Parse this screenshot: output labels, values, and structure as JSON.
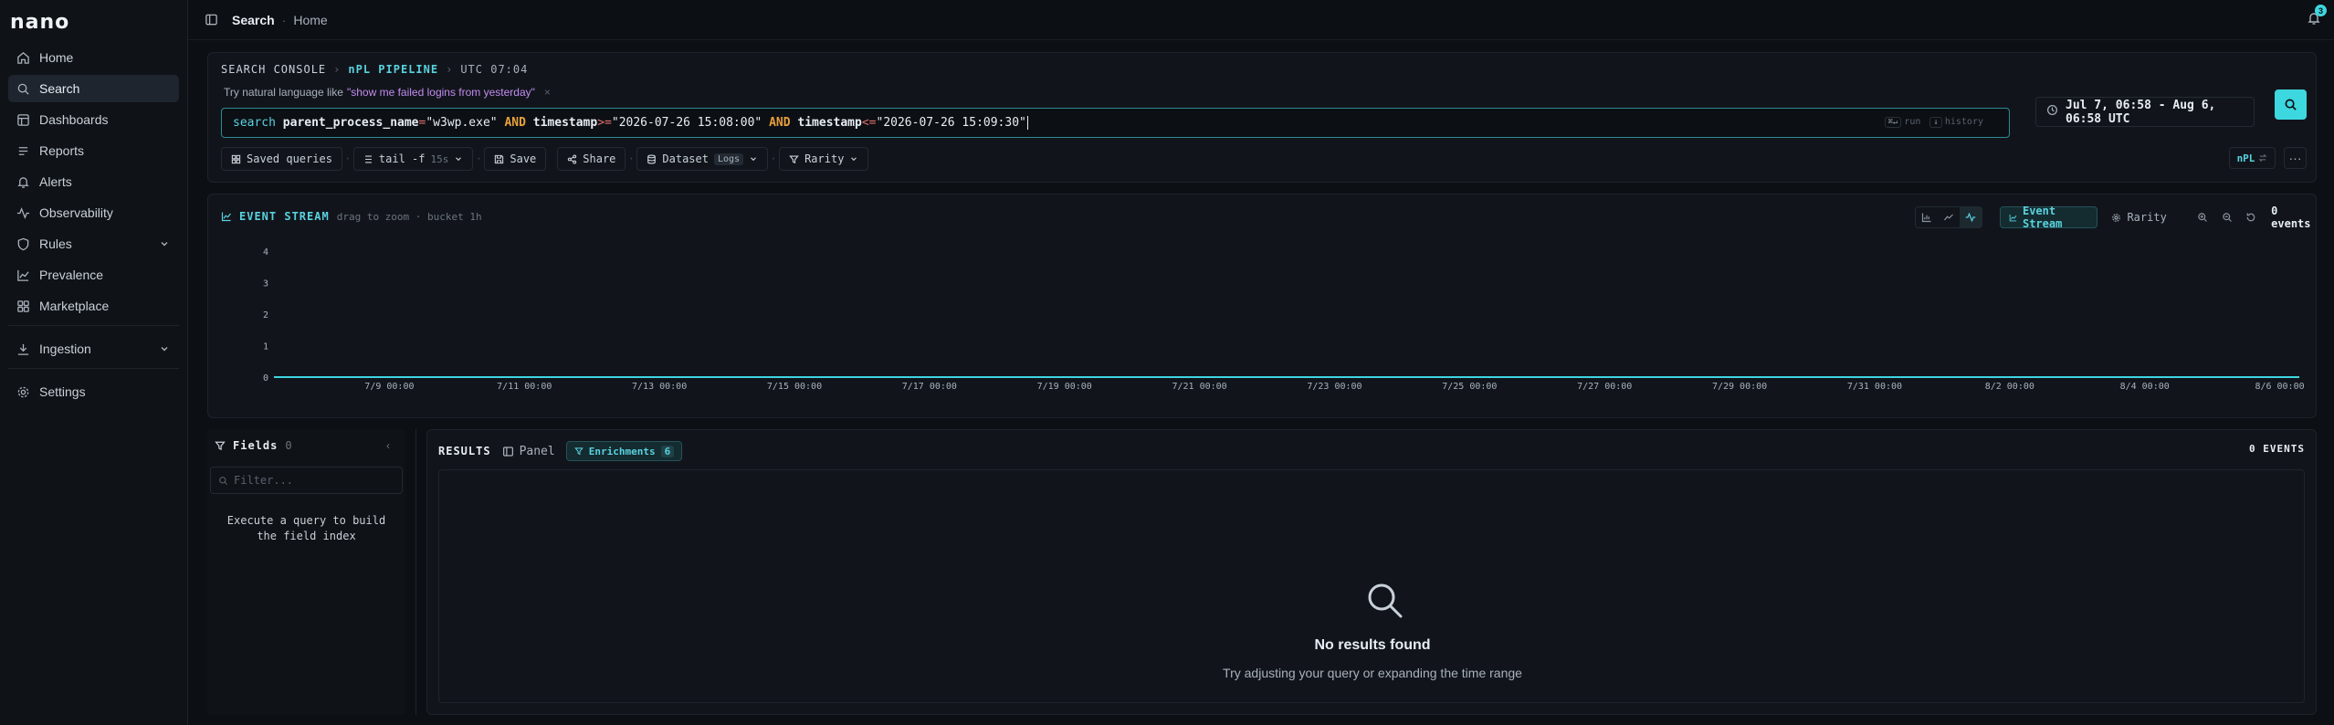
{
  "app": {
    "logo_text": "nano"
  },
  "sidebar": {
    "items": [
      {
        "label": "Home",
        "icon": "home-icon"
      },
      {
        "label": "Search",
        "icon": "search-icon",
        "active": true
      },
      {
        "label": "Dashboards",
        "icon": "dashboard-icon"
      },
      {
        "label": "Reports",
        "icon": "reports-icon"
      },
      {
        "label": "Alerts",
        "icon": "bell-icon"
      },
      {
        "label": "Observability",
        "icon": "activity-icon"
      },
      {
        "label": "Rules",
        "icon": "shield-icon",
        "expandable": true
      },
      {
        "label": "Prevalence",
        "icon": "chart-icon"
      },
      {
        "label": "Marketplace",
        "icon": "grid-icon"
      },
      {
        "label": "Ingestion",
        "icon": "download-icon",
        "expandable": true
      },
      {
        "label": "Settings",
        "icon": "gear-icon"
      }
    ]
  },
  "header": {
    "breadcrumb_current": "Search",
    "breadcrumb_sep": "·",
    "breadcrumb_parent": "Home",
    "notification_count": "3"
  },
  "console": {
    "title": "SEARCH CONSOLE",
    "sep": "›",
    "pipeline": "nPL PIPELINE",
    "clock": "UTC 07:04",
    "nl_prefix": "Try natural language like",
    "nl_example": "\"show me failed logins from yesterday\"",
    "nl_dismiss": "×",
    "query": {
      "kw": "search",
      "f1": "parent_process_name",
      "op1": "=",
      "v1": "\"w3wp.exe\"",
      "and1": "AND",
      "f2": "timestamp",
      "op2": ">=",
      "v2": "\"2026-07-26 15:08:00\"",
      "and2": "AND",
      "f3": "timestamp",
      "op3": "<=",
      "v3": "\"2026-07-26 15:09:30\""
    },
    "hint_run_key": "⌘↵",
    "hint_run": "run",
    "hint_history_key": "↓",
    "hint_history": "history",
    "time_range": "Jul 7, 06:58 - Aug 6, 06:58 UTC",
    "toolbar": {
      "saved_queries": "Saved queries",
      "tail": "tail -f",
      "tail_interval": "15s",
      "save": "Save",
      "share": "Share",
      "dataset": "Dataset",
      "dataset_tag": "Logs",
      "rarity": "Rarity",
      "dot": "·"
    },
    "npl_toggle": "nPL",
    "more": "···"
  },
  "event_stream": {
    "title": "EVENT STREAM",
    "subtitle": "drag to zoom · bucket 1h",
    "tab_stream": "Event Stream",
    "tab_rarity": "Rarity",
    "events_label": "0 events"
  },
  "chart_data": {
    "type": "line",
    "xlabel": "",
    "ylabel": "",
    "x_ticks": [
      "7/9 00:00",
      "7/11 00:00",
      "7/13 00:00",
      "7/15 00:00",
      "7/17 00:00",
      "7/19 00:00",
      "7/21 00:00",
      "7/23 00:00",
      "7/25 00:00",
      "7/27 00:00",
      "7/29 00:00",
      "7/31 00:00",
      "8/2 00:00",
      "8/4 00:00",
      "8/6 00:00"
    ],
    "y_ticks": [
      0,
      1,
      2,
      3,
      4
    ],
    "ylim": [
      0,
      4
    ],
    "xlim": [
      "7/7 06:58",
      "8/6 06:58"
    ],
    "series": [
      {
        "x": [
          "7/7 06:58",
          "8/6 06:58"
        ],
        "values": [
          0,
          0
        ],
        "color": "#3dd7e0"
      }
    ],
    "grid": false
  },
  "fields": {
    "title": "Fields",
    "count": "0",
    "collapse": "‹",
    "filter_placeholder": "Filter...",
    "empty_text": "Execute a query to build the field index"
  },
  "results": {
    "title": "RESULTS",
    "panel_label": "Panel",
    "enrichments_label": "Enrichments",
    "enrichments_count": "6",
    "count_label": "0 EVENTS",
    "empty_title": "No results found",
    "empty_sub": "Try adjusting your query or expanding the time range"
  },
  "colors": {
    "accent": "#3dd7e0",
    "accent_text": "#5ad2df",
    "and_keyword": "#e8a03a",
    "operator": "#e2706a",
    "nl_example": "#c38bf0",
    "bg": "#0c0f14",
    "panel": "#11151b"
  }
}
